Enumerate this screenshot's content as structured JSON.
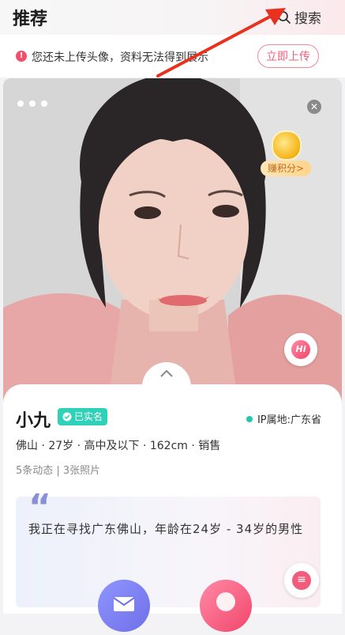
{
  "header": {
    "title": "推荐",
    "search_label": "搜索"
  },
  "notice": {
    "text": "您还未上传头像，资料无法得到展示",
    "upload_label": "立即上传"
  },
  "photo": {
    "earn_label": "赚积分>",
    "hi_label": "Hi"
  },
  "profile": {
    "name": "小九",
    "verified_label": "已实名",
    "ip_location": "IP属地:广东省",
    "attributes": "佛山 · 27岁 · 高中及以下 · 162cm · 销售",
    "stats": "5条动态 | 3张照片",
    "intro": "我正在寻找广东佛山，年龄在24岁 - 34岁的男性"
  },
  "colors": {
    "accent_pink": "#f2466b",
    "teal": "#2fd2b8",
    "violet": "#6f6fe8"
  },
  "icons": [
    "search-icon",
    "warning-icon",
    "close-icon",
    "coin-icon",
    "hi-icon",
    "chevron-up-icon",
    "check-icon",
    "quote-icon",
    "chat-icon",
    "mail-icon"
  ]
}
